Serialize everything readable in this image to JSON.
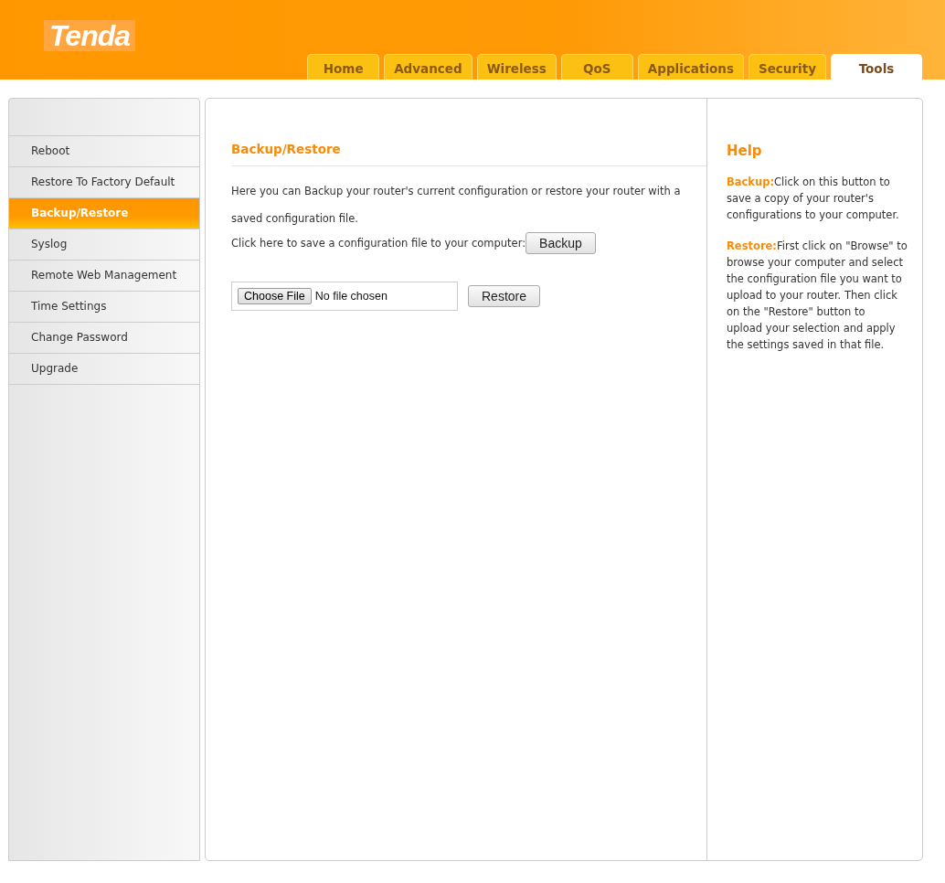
{
  "logo": "Tenda",
  "tabs": [
    {
      "label": "Home",
      "selected": false
    },
    {
      "label": "Advanced",
      "selected": false
    },
    {
      "label": "Wireless",
      "selected": false
    },
    {
      "label": "QoS",
      "selected": false
    },
    {
      "label": "Applications",
      "selected": false
    },
    {
      "label": "Security",
      "selected": false
    },
    {
      "label": "Tools",
      "selected": true
    }
  ],
  "sidebar": {
    "items": [
      {
        "label": "Reboot",
        "selected": false
      },
      {
        "label": "Restore To Factory Default",
        "selected": false
      },
      {
        "label": "Backup/Restore",
        "selected": true
      },
      {
        "label": "Syslog",
        "selected": false
      },
      {
        "label": "Remote Web Management",
        "selected": false
      },
      {
        "label": "Time Settings",
        "selected": false
      },
      {
        "label": "Change Password",
        "selected": false
      },
      {
        "label": "Upgrade",
        "selected": false
      }
    ]
  },
  "main": {
    "title": "Backup/Restore",
    "intro": "Here you can Backup your router's current configuration or restore your router with a saved configuration file.",
    "backup_prompt": "Click here to save a configuration file to your computer:",
    "backup_button": "Backup",
    "file_button": "Choose File",
    "file_status": "No file chosen",
    "restore_button": "Restore"
  },
  "help": {
    "title": "Help",
    "paragraphs": [
      {
        "term": "Backup:",
        "text": "Click on this button to save a copy of your router's configurations to your computer."
      },
      {
        "term": "Restore:",
        "text": "First click on \"Browse\" to browse your computer and select the configuration file you want to upload to your router. Then click on the \"Restore\" button to   upload your selection and apply the settings saved in that file."
      }
    ]
  }
}
